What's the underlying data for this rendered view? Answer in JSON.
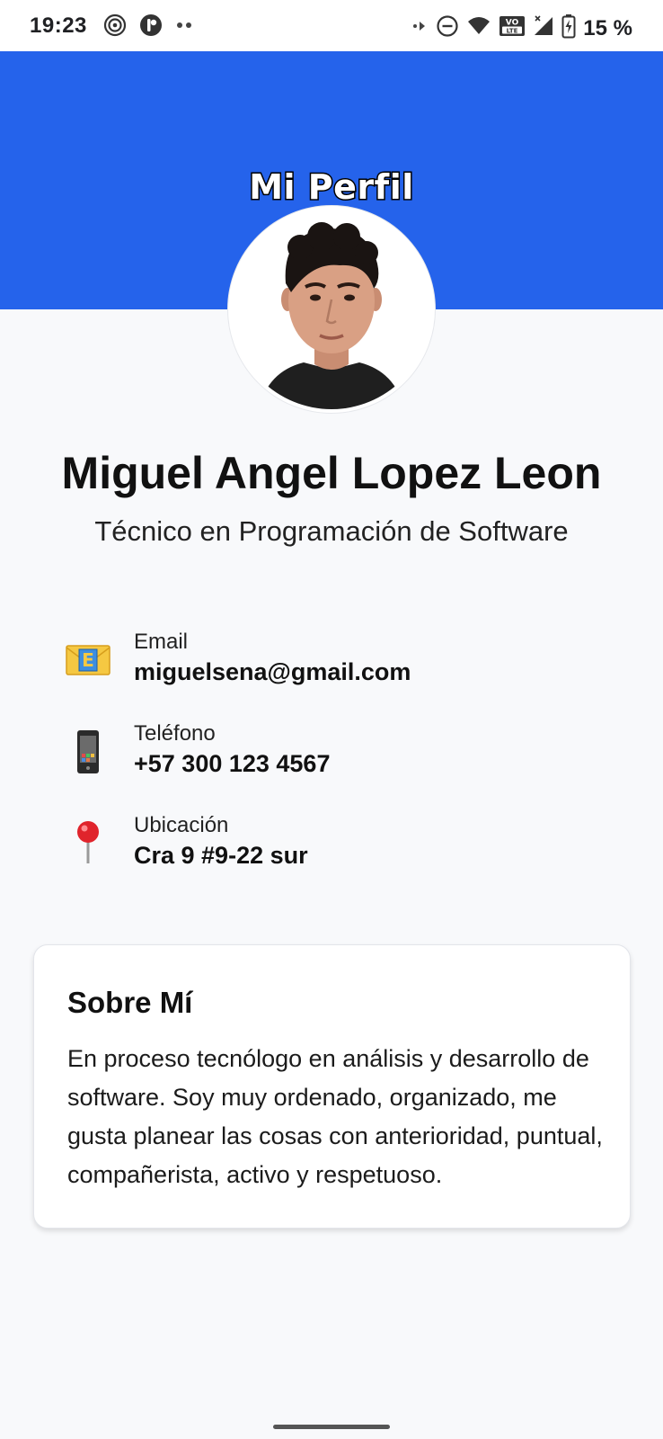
{
  "status_bar": {
    "time": "19:23",
    "battery_percent": "15 %",
    "icons": [
      "hotspot-icon",
      "app-notification-icon",
      "more-dots-icon",
      "data-activity-icon",
      "do-not-disturb-icon",
      "wifi-icon",
      "volte-icon",
      "signal-icon",
      "battery-charging-icon"
    ],
    "volte_text": "VO LTE"
  },
  "header": {
    "title": "Mi Perfil",
    "background_color": "#2563eb"
  },
  "profile": {
    "name": "Miguel Angel Lopez Leon",
    "role": "Técnico en Programación de Software"
  },
  "contacts": [
    {
      "icon": "envelope-icon",
      "label": "Email",
      "value": "miguelsena@gmail.com"
    },
    {
      "icon": "mobile-phone-icon",
      "label": "Teléfono",
      "value": "+57 300 123 4567"
    },
    {
      "icon": "map-pin-icon",
      "label": "Ubicación",
      "value": "Cra 9 #9-22 sur"
    }
  ],
  "about": {
    "title": "Sobre Mí",
    "text": "En proceso tecnólogo en análisis y desarrollo de software. Soy muy ordenado, organizado, me gusta planear las cosas con anterioridad, puntual, compañerista, activo y respetuoso."
  }
}
